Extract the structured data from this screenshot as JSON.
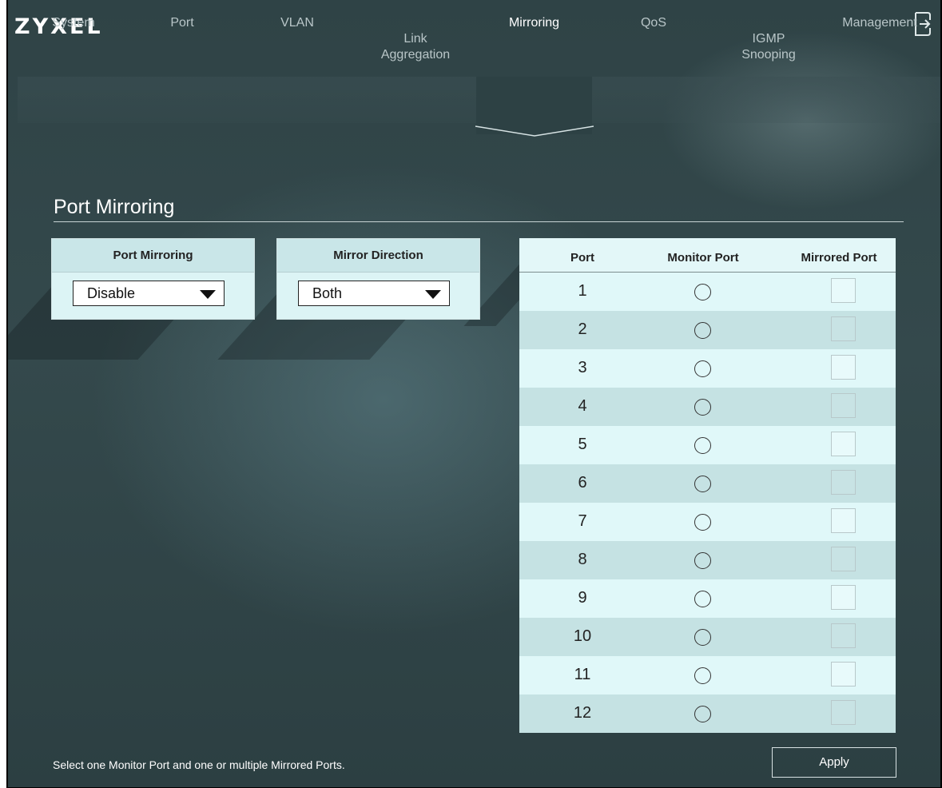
{
  "app": {
    "logo": "ZYXEL",
    "logout_icon": "logout-icon"
  },
  "tabs": [
    {
      "label": "System"
    },
    {
      "label": "Port"
    },
    {
      "label": "VLAN"
    },
    {
      "label": "Link\nAggregation"
    },
    {
      "label": "Mirroring",
      "active": true
    },
    {
      "label": "QoS"
    },
    {
      "label": "IGMP\nSnooping"
    },
    {
      "label": "Management"
    }
  ],
  "page": {
    "title": "Port Mirroring"
  },
  "port_mirroring_card": {
    "header": "Port Mirroring",
    "value": "Disable"
  },
  "mirror_direction_card": {
    "header": "Mirror Direction",
    "value": "Both"
  },
  "port_table": {
    "headers": {
      "port": "Port",
      "monitor": "Monitor Port",
      "mirrored": "Mirrored Port"
    },
    "rows": [
      {
        "port": "1",
        "monitor": false,
        "mirrored": false
      },
      {
        "port": "2",
        "monitor": false,
        "mirrored": false
      },
      {
        "port": "3",
        "monitor": false,
        "mirrored": false
      },
      {
        "port": "4",
        "monitor": false,
        "mirrored": false
      },
      {
        "port": "5",
        "monitor": false,
        "mirrored": false
      },
      {
        "port": "6",
        "monitor": false,
        "mirrored": false
      },
      {
        "port": "7",
        "monitor": false,
        "mirrored": false
      },
      {
        "port": "8",
        "monitor": false,
        "mirrored": false
      },
      {
        "port": "9",
        "monitor": false,
        "mirrored": false
      },
      {
        "port": "10",
        "monitor": false,
        "mirrored": false
      },
      {
        "port": "11",
        "monitor": false,
        "mirrored": false
      },
      {
        "port": "12",
        "monitor": false,
        "mirrored": false
      }
    ]
  },
  "footer": {
    "note": "Select one Monitor Port and one or multiple Mirrored Ports.",
    "apply_label": "Apply"
  }
}
